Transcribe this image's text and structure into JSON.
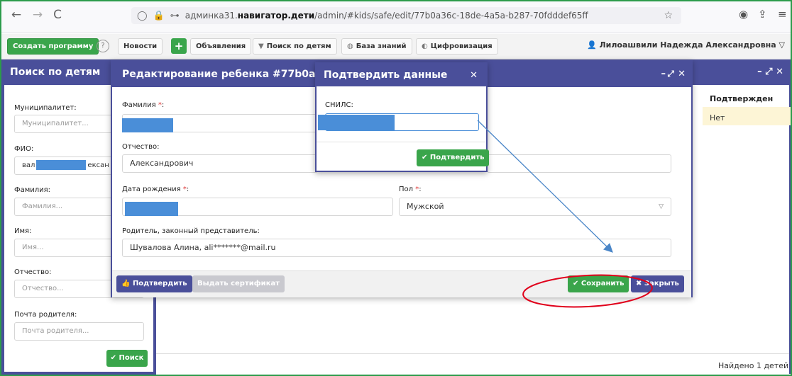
{
  "browser": {
    "back_icon": "←",
    "forward_icon": "→",
    "reload_icon": "C",
    "url_prefix": "админка31.",
    "url_domain": "навигатор.дети",
    "url_path": "/admin/#kids/safe/edit/77b0a36c-18de-4a5a-b287-70fdddef65ff"
  },
  "toolbar": {
    "create_program": "Создать программу",
    "help": "?",
    "news": "Новости",
    "plus": "+",
    "announcements": "Объявления",
    "search_children": "Поиск по детям",
    "knowledge_base": "База знаний",
    "digitalization": "Цифровизация",
    "user_name": "Лилоашвили Надежда Александровна"
  },
  "left_panel": {
    "title": "Поиск по детям",
    "fields": [
      {
        "label": "Муниципалитет:",
        "placeholder": "Муниципалитет..."
      },
      {
        "label": "ФИО:",
        "value_start": "вал",
        "value_end": "ексан"
      },
      {
        "label": "Фамилия:",
        "placeholder": "Фамилия..."
      },
      {
        "label": "Имя:",
        "placeholder": "Имя..."
      },
      {
        "label": "Отчество:",
        "placeholder": "Отчество..."
      },
      {
        "label": "Почта родителя:",
        "placeholder": "Почта родителя..."
      }
    ],
    "search_button": "Поиск"
  },
  "results": {
    "column_confirmed": "Подтвержден",
    "row_value": "Нет",
    "found": "Найдено 1 детей"
  },
  "modal": {
    "title": "Редактирование ребенка #77b0a36c-18de",
    "surname_label": "Фамилия",
    "patronymic_label": "Отчество:",
    "patronymic_value": "Александрович",
    "birthdate_label": "Дата рождения",
    "gender_label": "Пол",
    "gender_value": "Мужской",
    "parent_label": "Родитель, законный представитель:",
    "parent_value": "Шувалова Алина, ali*******@mail.ru",
    "required_mark": "*",
    "confirm_button": "Подтвердить",
    "certificate_button": "Выдать сертификат",
    "save_button": "Сохранить",
    "close_button": "Закрыть"
  },
  "confirm_dialog": {
    "title": "Подтвердить данные",
    "snils_label": "СНИЛС:",
    "confirm_button": "Подтвердить"
  },
  "colors": {
    "header_purple": "#4a4f9a",
    "green": "#3aa54b",
    "redaction_blue": "#4a8ed8",
    "annotation_red": "#e0001b",
    "annotation_arrow": "#4a86c8"
  }
}
